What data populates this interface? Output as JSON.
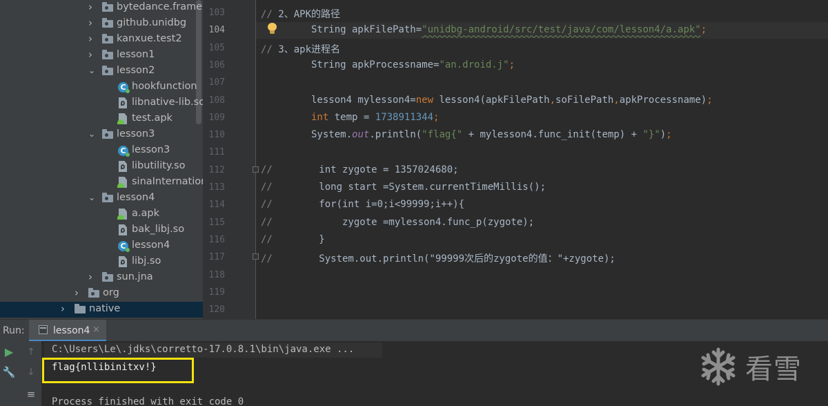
{
  "project_tree": {
    "items": [
      {
        "label": "bytedance.framew",
        "type": "package",
        "expanded": false,
        "level": 1
      },
      {
        "label": "github.unidbg",
        "type": "package",
        "expanded": false,
        "level": 1
      },
      {
        "label": "kanxue.test2",
        "type": "package",
        "expanded": false,
        "level": 1
      },
      {
        "label": "lesson1",
        "type": "package",
        "expanded": false,
        "level": 1
      },
      {
        "label": "lesson2",
        "type": "package",
        "expanded": true,
        "level": 1
      },
      {
        "label": "hookfunction",
        "type": "class",
        "level": 2
      },
      {
        "label": "libnative-lib.so",
        "type": "file",
        "level": 2
      },
      {
        "label": "test.apk",
        "type": "apk",
        "level": 2
      },
      {
        "label": "lesson3",
        "type": "package",
        "expanded": true,
        "level": 1
      },
      {
        "label": "lesson3",
        "type": "class",
        "level": 2
      },
      {
        "label": "libutility.so",
        "type": "file",
        "level": 2
      },
      {
        "label": "sinaInternationa",
        "type": "apk",
        "level": 2
      },
      {
        "label": "lesson4",
        "type": "package",
        "expanded": true,
        "level": 1
      },
      {
        "label": "a.apk",
        "type": "apk",
        "level": 2
      },
      {
        "label": "bak_libj.so",
        "type": "file",
        "level": 2
      },
      {
        "label": "lesson4",
        "type": "class",
        "level": 2
      },
      {
        "label": "libj.so",
        "type": "file",
        "level": 2
      },
      {
        "label": "sun.jna",
        "type": "package",
        "expanded": false,
        "level": 1
      },
      {
        "label": "org",
        "type": "package",
        "expanded": false,
        "level": 0
      },
      {
        "label": "native",
        "type": "folder",
        "expanded": false,
        "level": -1
      }
    ]
  },
  "editor": {
    "current_line": "104",
    "lines": [
      {
        "num": "103",
        "text": "// 2、APK的路径"
      },
      {
        "num": "104",
        "text": "String apkFilePath=\"unidbg-android/src/test/java/com/lesson4/a.apk\";"
      },
      {
        "num": "105",
        "text": "// 3、apk进程名"
      },
      {
        "num": "106",
        "text": "String apkProcessname=\"an.droid.j\";"
      },
      {
        "num": "107",
        "text": ""
      },
      {
        "num": "108",
        "text": "lesson4 mylesson4=new lesson4(apkFilePath,soFilePath,apkProcessname);"
      },
      {
        "num": "109",
        "text": "int temp = 1738911344;"
      },
      {
        "num": "110",
        "text": "System.out.println(\"flag{\" + mylesson4.func_init(temp) + \"}\");"
      },
      {
        "num": "111",
        "text": ""
      },
      {
        "num": "112",
        "text": "//        int zygote = 1357024680;"
      },
      {
        "num": "113",
        "text": "//        long start =System.currentTimeMillis();"
      },
      {
        "num": "114",
        "text": "//        for(int i=0;i<99999;i++){"
      },
      {
        "num": "115",
        "text": "//            zygote =mylesson4.func_p(zygote);"
      },
      {
        "num": "116",
        "text": "//        }"
      },
      {
        "num": "117",
        "text": "//        System.out.println(\"99999次后的zygote的值：\"+zygote);"
      },
      {
        "num": "118",
        "text": ""
      },
      {
        "num": "119",
        "text": ""
      },
      {
        "num": "120",
        "text": ""
      }
    ]
  },
  "run_panel": {
    "label": "Run:",
    "tab_label": "lesson4",
    "tab_close": "×",
    "console_lines": [
      "C:\\Users\\Le\\.jdks\\corretto-17.0.8.1\\bin\\java.exe ...",
      "flag{nllibinitxv!}",
      "",
      "Process finished with exit code 0"
    ],
    "highlight_color": "#f4e20f"
  },
  "watermark": {
    "text": "看雪",
    "icon": "snowflake-icon"
  },
  "colors": {
    "keyword": "#cc7832",
    "string": "#6a8759",
    "number": "#6897bb",
    "comment": "#808080",
    "static_field": "#9876aa",
    "accent": "#4a88c7"
  }
}
